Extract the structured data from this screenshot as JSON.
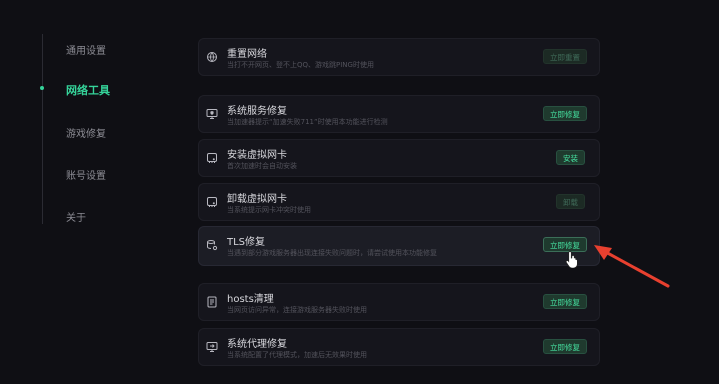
{
  "sidebar": {
    "items": [
      {
        "label": "通用设置"
      },
      {
        "label": "网络工具"
      },
      {
        "label": "游戏修复"
      },
      {
        "label": "账号设置"
      },
      {
        "label": "关于"
      }
    ]
  },
  "tools": [
    {
      "title": "重置网络",
      "desc": "当打不开网页、登不上QQ、游戏跳PING时使用",
      "button": "立即重置",
      "icon": "globe-reset-icon"
    },
    {
      "title": "系统服务修复",
      "desc": "当加速器提示“加速失败711”时使用本功能进行检测",
      "button": "立即修复",
      "icon": "monitor-shield-icon"
    },
    {
      "title": "安装虚拟网卡",
      "desc": "首次加速时会自动安装",
      "button": "安装",
      "icon": "network-card-icon"
    },
    {
      "title": "卸载虚拟网卡",
      "desc": "当系统提示网卡冲突时使用",
      "button": "卸载",
      "icon": "network-card-remove-icon"
    },
    {
      "title": "TLS修复",
      "desc": "当遇到部分游戏服务器出现连接失败问题时，请尝试使用本功能修复",
      "button": "立即修复",
      "icon": "database-gear-icon"
    },
    {
      "title": "hosts清理",
      "desc": "当网页访问异常，连接游戏服务器失败时使用",
      "button": "立即修复",
      "icon": "document-list-icon"
    },
    {
      "title": "系统代理修复",
      "desc": "当系统配置了代理模式，加速后无效果时使用",
      "button": "立即修复",
      "icon": "monitor-proxy-icon"
    }
  ],
  "colors": {
    "accent": "#35d39a",
    "annotation_arrow": "#e8402f"
  }
}
